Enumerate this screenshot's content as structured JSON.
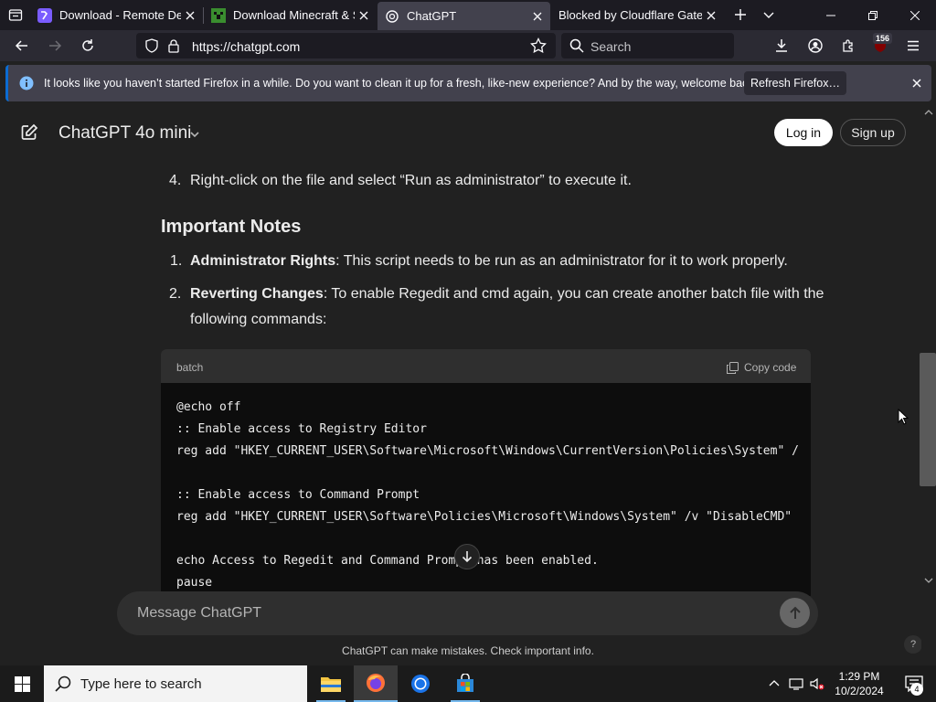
{
  "tabs": [
    {
      "title": "Download - Remote Desktop",
      "icon": "remote-desktop-favicon"
    },
    {
      "title": "Download Minecraft & Server",
      "icon": "minecraft-favicon"
    },
    {
      "title": "ChatGPT",
      "icon": "chatgpt-favicon"
    },
    {
      "title": "Blocked by Cloudflare Gateway",
      "icon": "none"
    }
  ],
  "address_bar": {
    "url": "https://chatgpt.com"
  },
  "search_bar": {
    "placeholder": "Search"
  },
  "extensions_badge": "156",
  "notification": {
    "message": "It looks like you haven’t started Firefox in a while. Do you want to clean it up for a fresh, like-new experience? And by the way, welcome back!",
    "button": "Refresh Firefox…"
  },
  "chat_header": {
    "model": "ChatGPT 4o mini",
    "login": "Log in",
    "signup": "Sign up"
  },
  "content": {
    "step4_num": "4.",
    "step4_text": "Right-click on the file and select “Run as administrator” to execute it.",
    "heading": "Important Notes",
    "notes": [
      {
        "num": "1.",
        "bold": "Administrator Rights",
        "text": ": This script needs to be run as an administrator for it to work properly."
      },
      {
        "num": "2.",
        "bold": "Reverting Changes",
        "text": ": To enable Regedit and cmd again, you can create another batch file with the",
        "text2": "following commands:"
      }
    ]
  },
  "code": {
    "language": "batch",
    "copy_label": "Copy code",
    "lines": [
      "@echo off",
      ":: Enable access to Registry Editor",
      "reg add \"HKEY_CURRENT_USER\\Software\\Microsoft\\Windows\\CurrentVersion\\Policies\\System\" /",
      "",
      ":: Enable access to Command Prompt",
      "reg add \"HKEY_CURRENT_USER\\Software\\Policies\\Microsoft\\Windows\\System\" /v \"DisableCMD\"",
      "",
      "echo Access to Regedit and Command Prompt has been enabled.",
      "pause"
    ]
  },
  "composer": {
    "placeholder": "Message ChatGPT"
  },
  "disclaimer": "ChatGPT can make mistakes. Check important info.",
  "help": "?",
  "taskbar": {
    "search_placeholder": "Type here to search",
    "time": "1:29 PM",
    "date": "10/2/2024",
    "notification_count": "4"
  },
  "colors": {
    "accent_blue": "#0b6cd2",
    "page_bg": "#212121",
    "code_bg": "#0d0d0d"
  }
}
